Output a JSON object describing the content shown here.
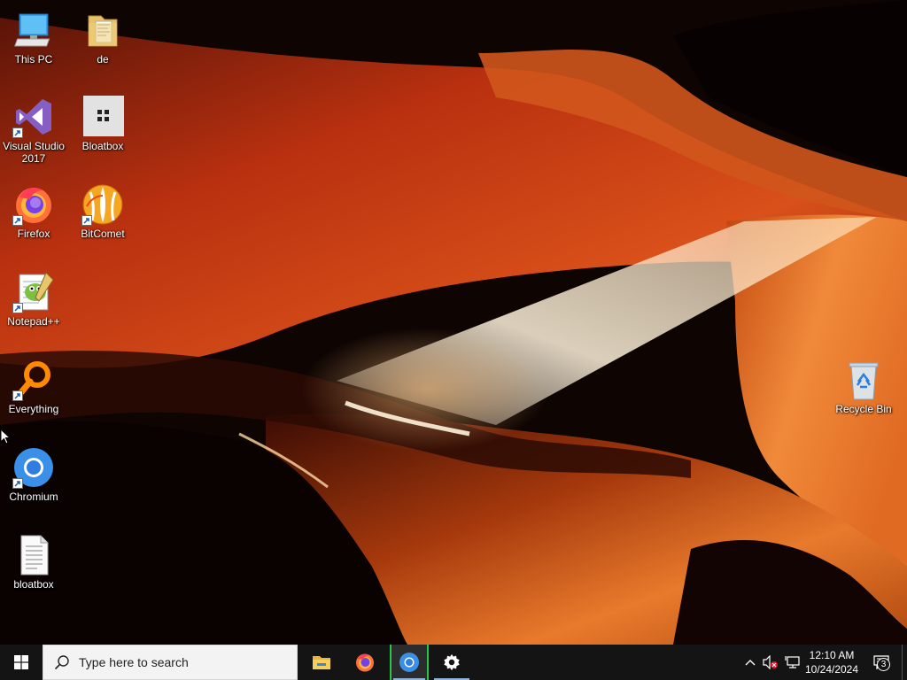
{
  "desktop": {
    "icons": [
      {
        "label": "This PC",
        "icon": "computer-icon"
      },
      {
        "label": "de",
        "icon": "folder-icon"
      },
      {
        "label": "Visual Studio 2017",
        "icon": "visual-studio-icon"
      },
      {
        "label": "Bloatbox",
        "icon": "bloatbox-icon"
      },
      {
        "label": "Firefox",
        "icon": "firefox-icon"
      },
      {
        "label": "BitComet",
        "icon": "bitcomet-icon"
      },
      {
        "label": "Notepad++",
        "icon": "notepadpp-icon"
      },
      {
        "label": "Everything",
        "icon": "everything-icon"
      },
      {
        "label": "Chromium",
        "icon": "chromium-icon"
      },
      {
        "label": "bloatbox",
        "icon": "text-file-icon"
      },
      {
        "label": "Recycle Bin",
        "icon": "recycle-bin-icon"
      }
    ]
  },
  "taskbar": {
    "search_placeholder": "Type here to search",
    "apps": [
      {
        "name": "File Explorer",
        "icon": "file-explorer-icon",
        "active": false
      },
      {
        "name": "Firefox",
        "icon": "firefox-icon",
        "active": false
      },
      {
        "name": "Chromium",
        "icon": "chromium-icon",
        "active": true
      },
      {
        "name": "Settings",
        "icon": "gear-icon",
        "active": false
      }
    ],
    "tray": {
      "time": "12:10 AM",
      "date": "10/24/2024",
      "notification_count": "3"
    }
  },
  "colors": {
    "taskbar_bg": "#141414",
    "search_bg": "#f3f3f3",
    "accent_blue": "#8fb3d9"
  }
}
